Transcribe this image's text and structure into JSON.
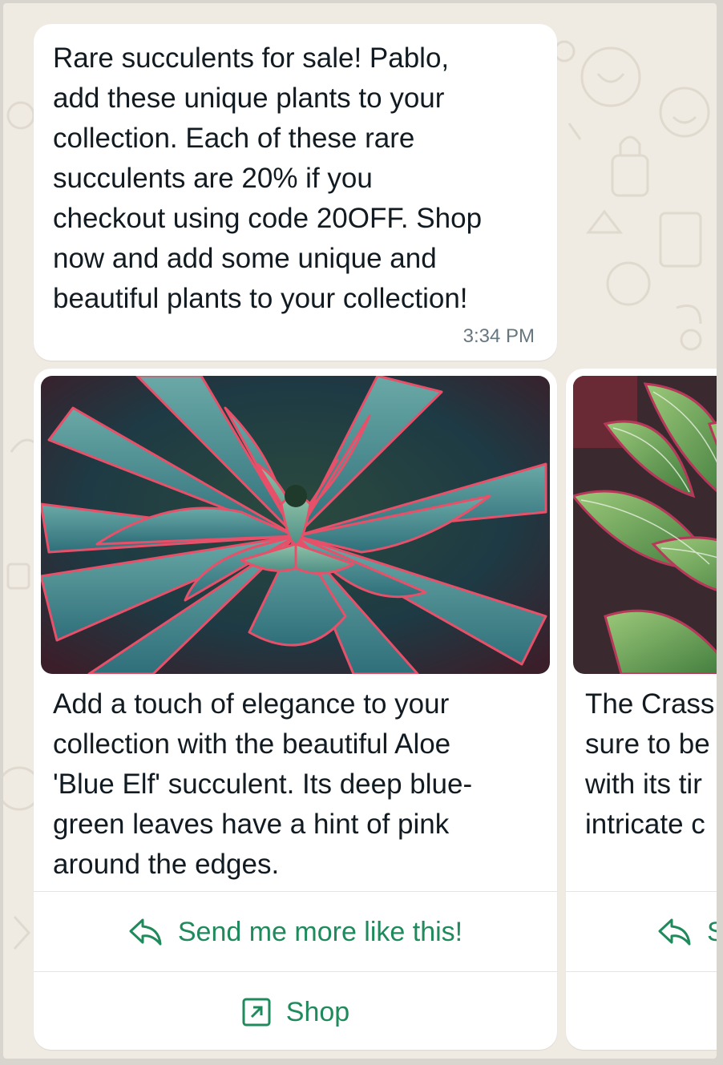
{
  "message": {
    "text": "Rare succulents for sale! Pablo,\nadd these unique plants to your\ncollection. Each of these rare\nsucculents are 20% if you\ncheckout using code 20OFF. Shop\nnow and add some unique and\nbeautiful plants to your collection!",
    "time": "3:34 PM"
  },
  "cards": [
    {
      "description": "Add a touch of elegance to your\ncollection with the beautiful Aloe\n'Blue Elf' succulent. Its deep blue-\ngreen leaves have a hint of pink\naround the edges.",
      "quick_reply_label": "Send me more like this!",
      "url_button_label": "Shop"
    },
    {
      "description": "The Crass\nsure to be\nwith its tir\nintricate c",
      "quick_reply_label": "S"
    }
  ],
  "colors": {
    "chat_background": "#efeae2",
    "bubble": "#ffffff",
    "button_text": "#1f8a5b",
    "timestamp": "#667781"
  },
  "icons": {
    "quick_reply": "reply-arrow-icon",
    "url_button": "external-link-icon"
  }
}
